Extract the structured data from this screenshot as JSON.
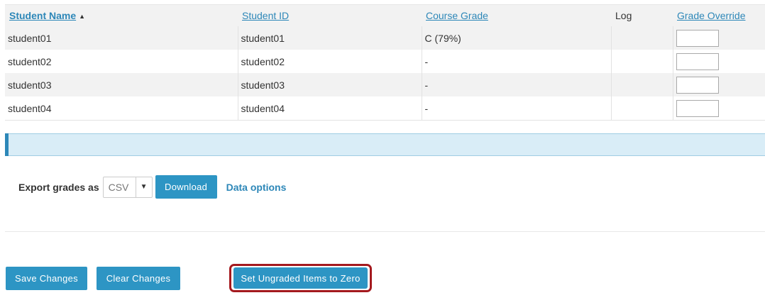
{
  "table": {
    "headers": {
      "student_name": "Student Name",
      "sort_icon": "sort-ascending-icon",
      "student_id": "Student ID",
      "course_grade": "Course Grade",
      "log": "Log",
      "grade_override": "Grade Override"
    },
    "rows": [
      {
        "name": "student01",
        "id": "student01",
        "grade": "C (79%)",
        "override": ""
      },
      {
        "name": "student02",
        "id": "student02",
        "grade": "-",
        "override": ""
      },
      {
        "name": "student03",
        "id": "student03",
        "grade": "-",
        "override": ""
      },
      {
        "name": "student04",
        "id": "student04",
        "grade": "-",
        "override": ""
      }
    ]
  },
  "export": {
    "label": "Export grades as",
    "format_selected": "CSV",
    "download_label": "Download",
    "data_options_label": "Data options"
  },
  "actions": {
    "save_label": "Save Changes",
    "clear_label": "Clear Changes",
    "zero_label": "Set Ungraded Items to Zero"
  },
  "colors": {
    "primary_button": "#2d95c4",
    "link": "#2d87b8",
    "info_banner": "#d9edf7",
    "highlight_border": "#a4191e"
  }
}
